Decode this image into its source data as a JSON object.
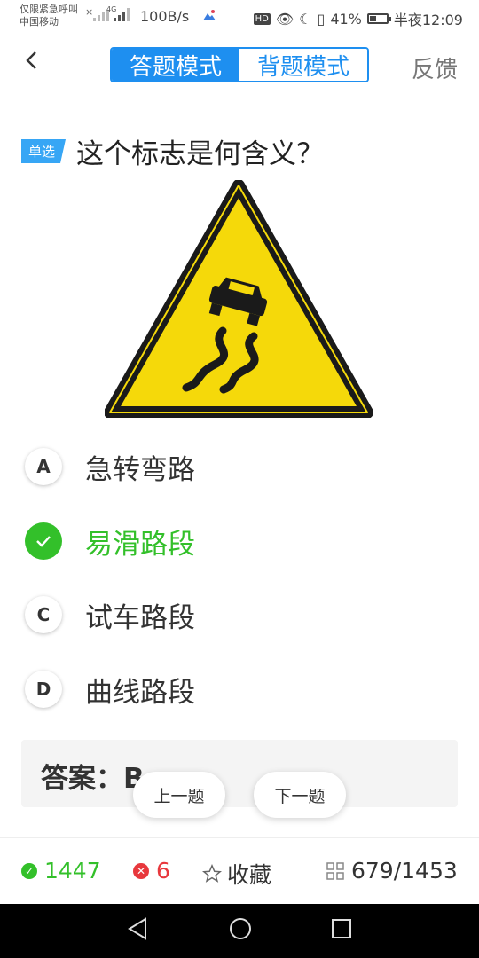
{
  "status_bar": {
    "carrier_line1": "仅限紧急呼叫",
    "carrier_line2": "中国移动",
    "network_type": "4G",
    "speed": "100B/s",
    "hd": "HD",
    "battery": "41%",
    "battery_level": 0.41,
    "time": "半夜12:09"
  },
  "header": {
    "back_icon": "chevron-left-icon",
    "mode_answer": "答题模式",
    "mode_memorize": "背题模式",
    "feedback": "反馈"
  },
  "question": {
    "type_badge": "单选",
    "text": "这个标志是何含义？"
  },
  "options": [
    {
      "letter": "A",
      "label": "急转弯路"
    },
    {
      "letter": "B",
      "label": "易滑路段",
      "correct": true
    },
    {
      "letter": "C",
      "label": "试车路段"
    },
    {
      "letter": "D",
      "label": "曲线路段"
    }
  ],
  "answer": {
    "label": "答案：B"
  },
  "nav": {
    "prev": "上一题",
    "next": "下一题"
  },
  "stats": {
    "correct_count": "1447",
    "wrong_count": "6",
    "favorite": "收藏",
    "progress": "679/1453"
  },
  "colors": {
    "accent": "#1e8ff0",
    "correct": "#33c02a",
    "wrong": "#e8383d"
  }
}
